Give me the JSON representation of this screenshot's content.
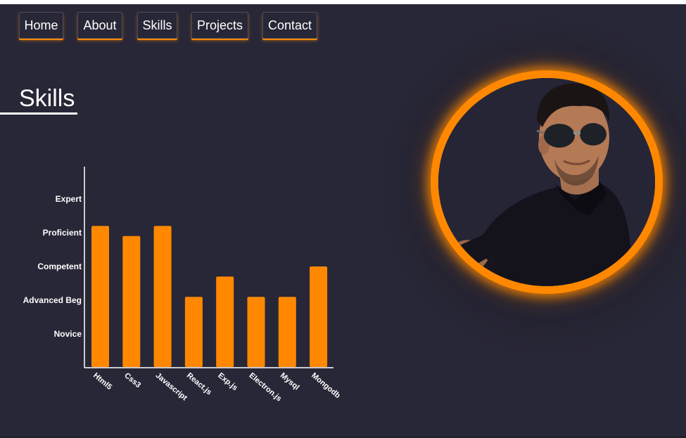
{
  "nav": {
    "items": [
      {
        "label": "Home",
        "active": true
      },
      {
        "label": "About",
        "active": false
      },
      {
        "label": "Skills",
        "active": true
      },
      {
        "label": "Projects",
        "active": false
      },
      {
        "label": "Contact",
        "active": false
      }
    ]
  },
  "skills": {
    "title": "Skills"
  },
  "colors": {
    "accent": "#ff8800",
    "background": "#282737",
    "text": "#ffffff"
  },
  "chart_data": {
    "type": "bar",
    "categories": [
      "Html5",
      "Css3",
      "Javascript",
      "React.js",
      "Exp.js",
      "Electron.js",
      "Mysql",
      "Mongodb"
    ],
    "levels": [
      "Novice",
      "Advanced Beg",
      "Competent",
      "Proficient",
      "Expert"
    ],
    "values": [
      4.2,
      3.9,
      4.2,
      2.1,
      2.7,
      2.1,
      2.1,
      3.0
    ],
    "ylim": [
      0,
      6
    ],
    "grid": false,
    "color": "#ff8800"
  },
  "avatar": {
    "icon": "profile-photo"
  }
}
